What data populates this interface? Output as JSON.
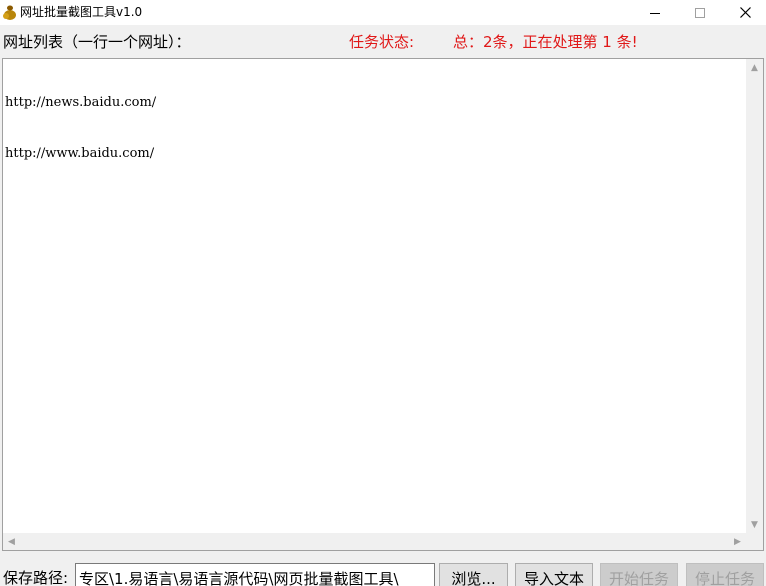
{
  "window": {
    "title": "网址批量截图工具v1.0",
    "controls": {
      "minimize": "—",
      "maximize": "☐",
      "close": "✕"
    }
  },
  "labels": {
    "url_list": "网址列表（一行一个网址）：",
    "task_status": "任务状态:",
    "status_text": "总：2条，正在处理第 1 条!"
  },
  "url_list": {
    "lines": [
      "http://news.baidu.com/",
      "http://www.baidu.com/"
    ]
  },
  "save": {
    "label": "保存路径:",
    "path_value": "专区\\1.易语言\\易语言源代码\\网页批量截图工具\\"
  },
  "buttons": {
    "browse": "浏览...",
    "import_text": "导入文本",
    "start_task": "开始任务",
    "stop_task": "停止任务"
  },
  "colors": {
    "status_red": "#e01818",
    "disabled_text": "#a0a0a0"
  },
  "icons": {
    "app": "money-bag-icon",
    "minimize": "minimize-icon",
    "maximize": "maximize-icon",
    "close": "close-icon"
  }
}
